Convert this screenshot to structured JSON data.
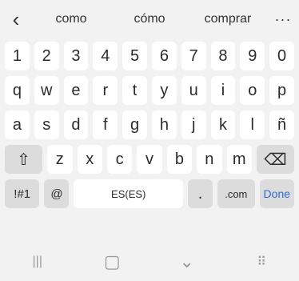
{
  "suggestions": {
    "back_glyph": "‹",
    "items": [
      "como",
      "cómo",
      "comprar"
    ],
    "more_glyph": "···"
  },
  "keyboard": {
    "number_row": [
      "1",
      "2",
      "3",
      "4",
      "5",
      "6",
      "7",
      "8",
      "9",
      "0"
    ],
    "row1": [
      "q",
      "w",
      "e",
      "r",
      "t",
      "y",
      "u",
      "i",
      "o",
      "p"
    ],
    "row2": [
      "a",
      "s",
      "d",
      "f",
      "g",
      "h",
      "j",
      "k",
      "l",
      "ñ"
    ],
    "row3": [
      "z",
      "x",
      "c",
      "v",
      "b",
      "n",
      "m"
    ],
    "shift_glyph": "⇧",
    "backspace_glyph": "⌫",
    "bottom": {
      "symbols": "!#1",
      "at": "@",
      "space": "ES(ES)",
      "period": ".",
      "com": ".com",
      "done": "Done"
    }
  },
  "navbar": {
    "recents_glyph": "|||",
    "home_glyph": "▢",
    "back_glyph": "⌄",
    "keyboard_glyph": "⠿"
  },
  "colors": {
    "background": "#f2f2f2",
    "key": "#ffffff",
    "function_key": "#dcdcdc",
    "accent": "#2e6bd6"
  }
}
